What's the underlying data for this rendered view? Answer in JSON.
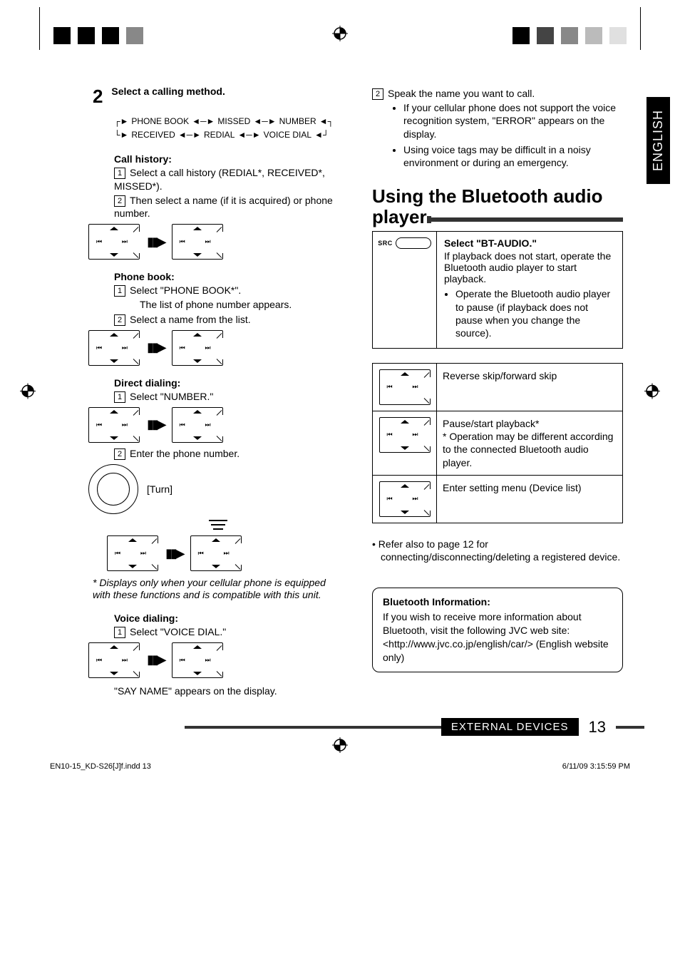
{
  "language_tab": "ENGLISH",
  "step2": {
    "number": "2",
    "text": "Select a calling method."
  },
  "flow": {
    "phone_book": "PHONE BOOK",
    "missed": "MISSED",
    "number": "NUMBER",
    "received": "RECEIVED",
    "redial": "REDIAL",
    "voice_dial": "VOICE DIAL"
  },
  "call_history": {
    "heading": "Call history:",
    "step1": "Select a call history (REDIAL*, RECEIVED*, MISSED*).",
    "step2": "Then select a name (if it is acquired) or phone number."
  },
  "phone_book": {
    "heading": "Phone book:",
    "step1": "Select \"PHONE BOOK*\".",
    "step1_sub": "The list of phone number appears.",
    "step2": "Select a name from the list."
  },
  "direct_dialing": {
    "heading": "Direct dialing:",
    "step1": "Select \"NUMBER.\"",
    "step2": "Enter the phone number.",
    "turn_label": "[Turn]"
  },
  "footnote": "*  Displays only when your cellular phone is equipped with these functions and is compatible with this unit.",
  "voice_dialing": {
    "heading": "Voice dialing:",
    "step1": "Select \"VOICE DIAL.\"",
    "result": "\"SAY NAME\" appears on the display."
  },
  "right_steps": {
    "step2": "Speak the name you want to call.",
    "bullet1": "If your cellular phone does not support the voice recognition system, \"ERROR\" appears on the display.",
    "bullet2": "Using voice tags may be difficult in a noisy environment or during an emergency."
  },
  "section_title_line1": "Using the Bluetooth audio",
  "section_title_line2": "player",
  "bt_audio": {
    "src_label": "SRC",
    "select_heading": "Select \"BT-AUDIO.\"",
    "body": "If playback does not start, operate the Bluetooth audio player to start playback.",
    "bullet": "Operate the Bluetooth audio player to pause (if playback does not pause when you change the source)."
  },
  "ctrl_table": {
    "row1": "Reverse skip/forward skip",
    "row2_line1": "Pause/start playback*",
    "row2_line2": "* Operation may be different according to the connected Bluetooth audio player.",
    "row3": "Enter setting menu (Device list)"
  },
  "refer_note": "Refer also to page 12 for connecting/disconnecting/deleting a registered device.",
  "bt_info": {
    "heading": "Bluetooth Information:",
    "body": "If you wish to receive more information about Bluetooth, visit the following JVC web site: <http://www.jvc.co.jp/english/car/> (English website only)"
  },
  "footer": {
    "label": "EXTERNAL DEVICES",
    "page": "13"
  },
  "imprint": {
    "file": "EN10-15_KD-S26[J]f.indd   13",
    "date": "6/11/09   3:15:59 PM"
  },
  "nums": {
    "n1": "1",
    "n2": "2"
  },
  "glyphs": {
    "skip_back": "⏮",
    "skip_fwd": "⏭"
  }
}
